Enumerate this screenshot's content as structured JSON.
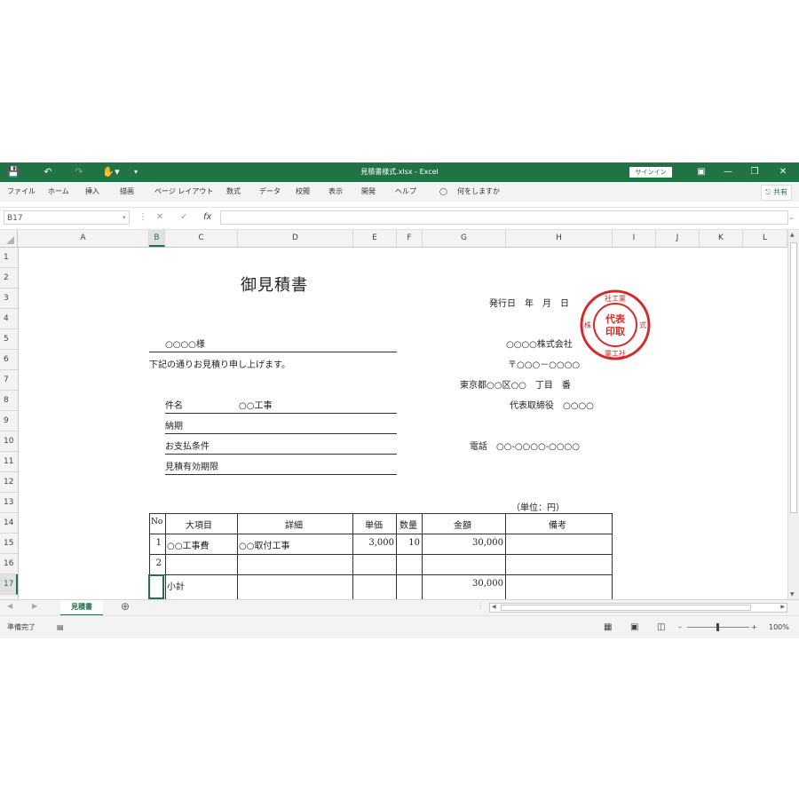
{
  "titlebar": {
    "title": "見積書様式.xlsx  -  Excel",
    "signin": "サインイン",
    "accent": "#217346"
  },
  "menu": {
    "items": [
      "ファイル",
      "ホーム",
      "挿入",
      "描画",
      "ページ レイアウト",
      "数式",
      "データ",
      "校閲",
      "表示",
      "開発",
      "ヘルプ"
    ],
    "search": "何をしますか",
    "share": "共有"
  },
  "formula_bar": {
    "name_box": "B17",
    "fx": "fx",
    "value": ""
  },
  "columns": [
    "A",
    "B",
    "C",
    "D",
    "E",
    "F",
    "G",
    "H",
    "I",
    "J",
    "K",
    "L"
  ],
  "rows": [
    "1",
    "2",
    "3",
    "4",
    "5",
    "6",
    "7",
    "8",
    "9",
    "10",
    "11",
    "12",
    "13",
    "14",
    "15",
    "16",
    "17"
  ],
  "doc": {
    "title": "御見積書",
    "issue_label": "発行日　年　月　日",
    "recipient": "○○○○様",
    "intro": "下記の通りお見積り申し上げます。",
    "company": "○○○○株式会社",
    "postal": "〒○○○－○○○○",
    "address": "東京都○○区○○　丁目　番",
    "representative": "代表取締役　○○○○",
    "phone": "電話　○○-○○○○-○○○○",
    "fields": [
      {
        "label": "件名",
        "value": "○○工事"
      },
      {
        "label": "納期",
        "value": ""
      },
      {
        "label": "お支払条件",
        "value": ""
      },
      {
        "label": "見積有効期限",
        "value": ""
      }
    ],
    "unit_note": "（単位：円）",
    "table_headers": [
      "No",
      "大項目",
      "詳細",
      "単価",
      "数量",
      "金額",
      "備考"
    ],
    "table_rows": [
      {
        "no": "1",
        "major": "○○工事費",
        "detail": "○○取付工事",
        "price": "3,000",
        "qty": "10",
        "amount": "30,000",
        "note": ""
      },
      {
        "no": "2",
        "major": "",
        "detail": "",
        "price": "",
        "qty": "",
        "amount": "",
        "note": ""
      },
      {
        "no": "",
        "major": "小計",
        "detail": "",
        "price": "",
        "qty": "",
        "amount": "30,000",
        "note": ""
      }
    ],
    "seal_text": [
      "代表",
      "取締",
      "役印",
      "株式会社工業"
    ],
    "seal_color": "#d42a2a"
  },
  "sheet_tab": "見積書",
  "status": {
    "ready": "準備完了",
    "zoom": "100%"
  }
}
